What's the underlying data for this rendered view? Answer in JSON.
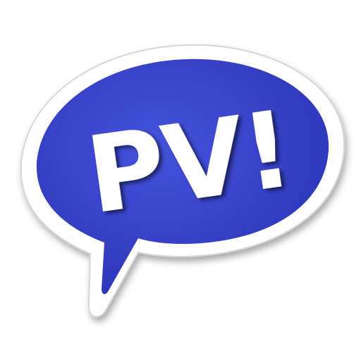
{
  "app_icon": {
    "logo_text": "PV!",
    "icon_name": "speech-bubble-icon",
    "colors": {
      "bubble_fill": "#3a46cf",
      "bubble_fill_dark": "#2b34b6",
      "border": "#ffffff",
      "border_shadow": "#c9c9c9",
      "text": "#ffffff",
      "text_shadow": "#7e7e7e"
    }
  }
}
